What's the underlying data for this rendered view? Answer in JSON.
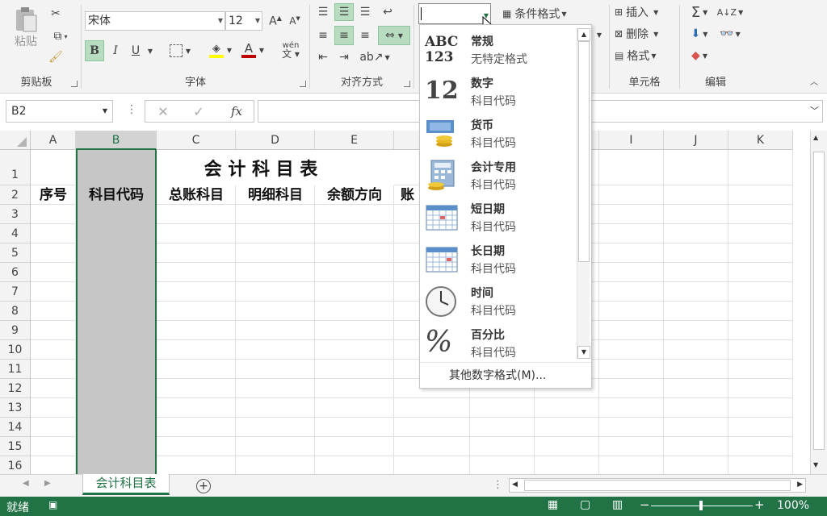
{
  "ribbon": {
    "clipboard": {
      "paste_label": "粘贴",
      "group_label": "剪贴板"
    },
    "font": {
      "font_name": "宋体",
      "font_size": "12",
      "bold": "B",
      "italic": "I",
      "underline": "U",
      "pinyin": "wén",
      "group_label": "字体"
    },
    "alignment": {
      "group_label": "对齐方式"
    },
    "number": {
      "format_value": ""
    },
    "styles": {
      "conditional_format": "条件格式"
    },
    "cells": {
      "insert": "插入",
      "delete": "删除",
      "format": "格式",
      "group_label": "单元格"
    },
    "editing": {
      "group_label": "编辑"
    }
  },
  "formula_bar": {
    "name_box": "B2",
    "fx": "fx",
    "value": ""
  },
  "columns": [
    "A",
    "B",
    "C",
    "D",
    "E",
    "F",
    "G",
    "H",
    "I",
    "J",
    "K"
  ],
  "rows": [
    "1",
    "2",
    "3",
    "4",
    "5",
    "6",
    "7",
    "8",
    "9",
    "10",
    "11",
    "12",
    "13",
    "14",
    "15",
    "16"
  ],
  "sheet": {
    "title": "会 计 科 目 表",
    "headers": [
      "序号",
      "科目代码",
      "总账科目",
      "明细科目",
      "余额方向",
      "账"
    ]
  },
  "number_format_menu": {
    "items": [
      {
        "icon": "abc-123-icon",
        "icon_text": [
          "ABC",
          "123"
        ],
        "name": "常规",
        "preview": "无特定格式"
      },
      {
        "icon": "number-12-icon",
        "icon_text": [
          "12"
        ],
        "name": "数字",
        "preview": "科目代码"
      },
      {
        "icon": "currency-icon",
        "name": "货币",
        "preview": "科目代码"
      },
      {
        "icon": "accounting-icon",
        "name": "会计专用",
        "preview": "科目代码"
      },
      {
        "icon": "short-date-icon",
        "name": "短日期",
        "preview": "科目代码"
      },
      {
        "icon": "long-date-icon",
        "name": "长日期",
        "preview": "科目代码"
      },
      {
        "icon": "clock-icon",
        "name": "时间",
        "preview": "科目代码"
      },
      {
        "icon": "percent-icon",
        "icon_text": [
          "%"
        ],
        "name": "百分比",
        "preview": "科目代码"
      }
    ],
    "more": "其他数字格式(M)..."
  },
  "tabs": {
    "active": "会计科目表"
  },
  "status": {
    "ready": "就绪",
    "zoom": "100%"
  },
  "colors": {
    "accent": "#217346",
    "selected_col": "#c6c6c6",
    "highlight": "#b7dcc0"
  }
}
